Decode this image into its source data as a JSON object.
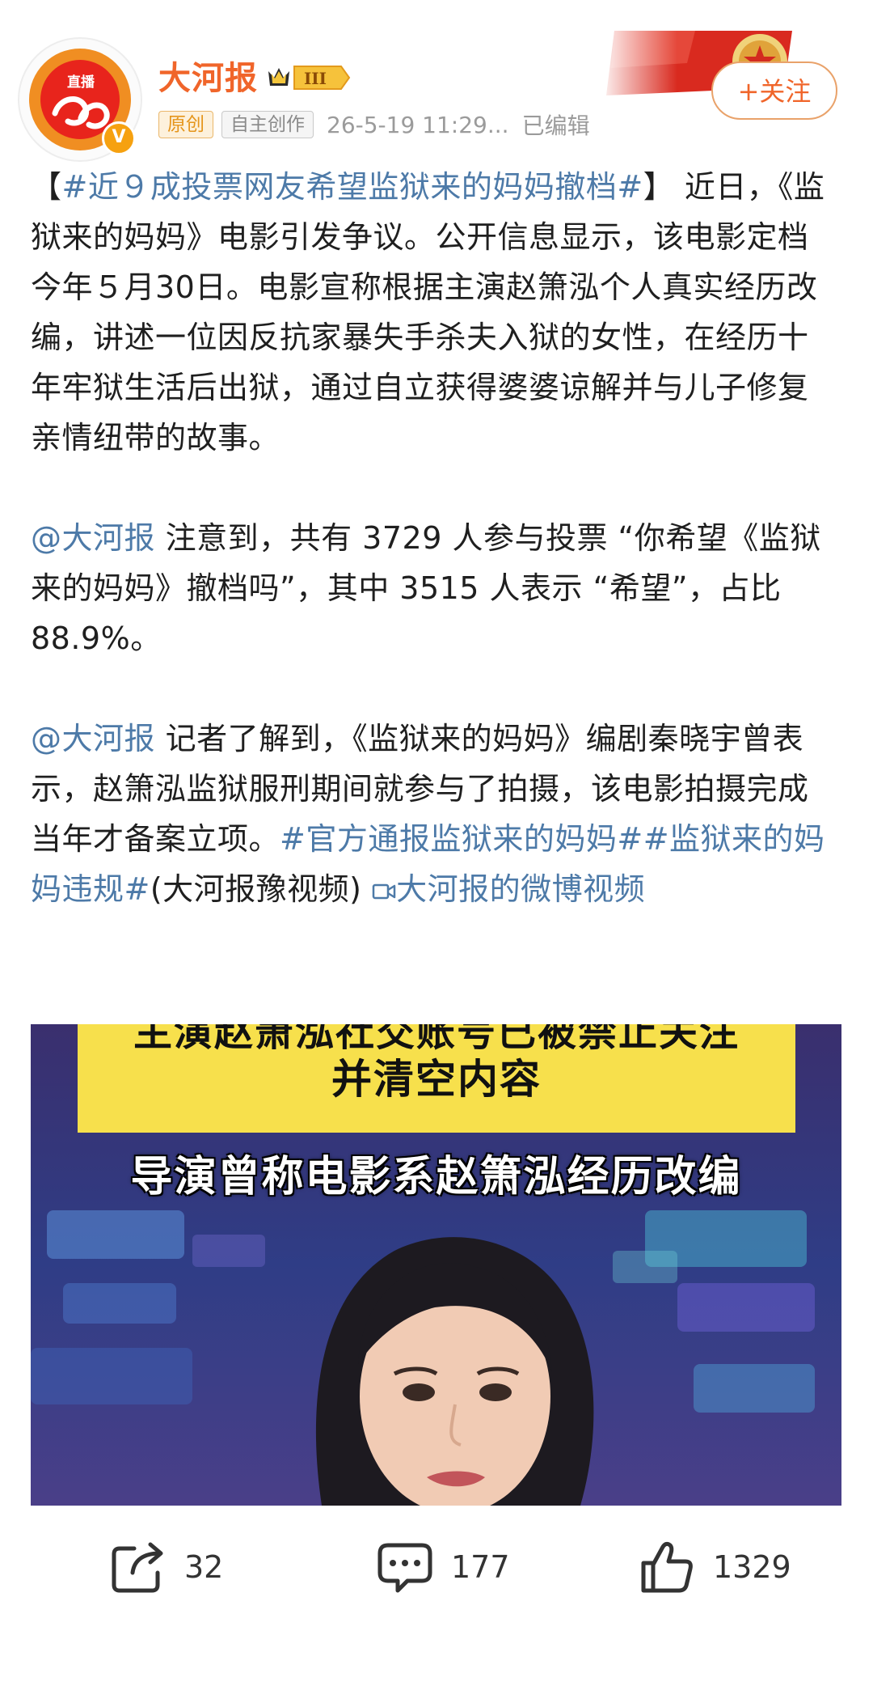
{
  "header": {
    "avatar_live_label": "直播",
    "avatar_verified_mark": "V",
    "username": "大河报",
    "vip_level": "III",
    "tag_original": "原创",
    "tag_self_created": "自主创作",
    "timestamp": "26-5-19 11:29...",
    "edited": "已编辑",
    "follow_button": "+关注"
  },
  "post": {
    "p1": {
      "bracket_open": "【",
      "hashtag": "#近９成投票网友希望监狱来的妈妈撤档#",
      "bracket_close": "】",
      "text": "近日，《监狱来的妈妈》电影引发争议。公开信息显示，该电影定档今年５月30日。电影宣称根据主演赵箫泓个人真实经历改编，讲述一位因反抗家暴失手杀夫入狱的女性，在经历十年牢狱生活后出狱，通过自立获得婆婆谅解并与儿子修复亲情纽带的故事。"
    },
    "p2": {
      "mention": "@大河报",
      "text": " 注意到，共有 3729 人参与投票 “你希望《监狱来的妈妈》撤档吗”，其中 3515 人表示 “希望”，占比 88.9%。"
    },
    "p3": {
      "mention": "@大河报",
      "text": " 记者了解到，《监狱来的妈妈》编剧秦晓宇曾表示，赵箫泓监狱服刑期间就参与了拍摄，该电影拍摄完成当年才备案立项。",
      "hashtag1": "#官方通报监狱来的妈妈#",
      "hashtag2": "#监狱来的妈妈违规#",
      "source": "(大河报豫视频)",
      "video_link_icon": "video-link-icon",
      "video_link": "大河报的微博视频"
    }
  },
  "video": {
    "caption_top_line1": "主演赵箫泓社交账号已被禁止关注",
    "caption_top_line2": "并清空内容",
    "caption_sub": "导演曾称电影系赵箫泓经历改编"
  },
  "actions": {
    "share_count": "32",
    "comment_count": "177",
    "like_count": "1329"
  },
  "colors": {
    "brand_orange": "#f0652a",
    "link_blue": "#4d7aa8",
    "caption_yellow": "#f7e04c"
  }
}
